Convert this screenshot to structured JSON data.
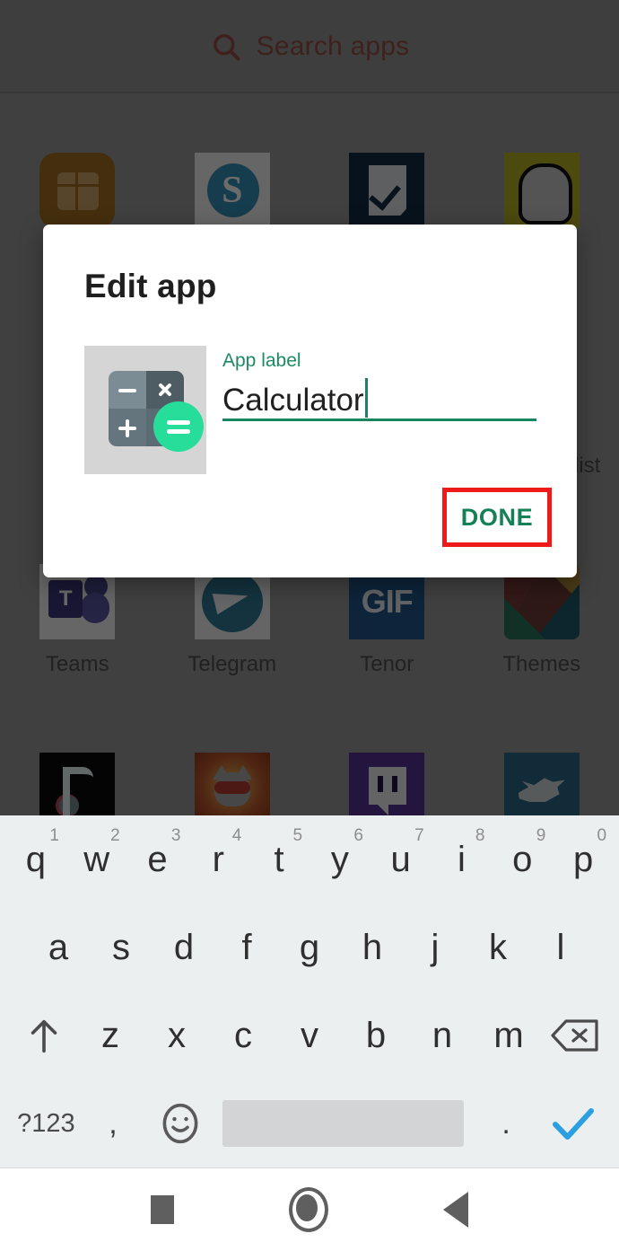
{
  "launcher": {
    "search": {
      "placeholder": "Search apps",
      "icon": "search-icon",
      "text_color": "#6b3a32"
    },
    "partial_label_right": "list",
    "rows": [
      {
        "apps": [
          {
            "name": "",
            "icon": "sim-toolkit-icon"
          },
          {
            "name": "",
            "icon": "skype-icon",
            "glyph": "S"
          },
          {
            "name": "",
            "icon": "todo-checkmark-icon"
          },
          {
            "name": "",
            "icon": "snapchat-icon"
          }
        ]
      },
      {
        "apps": [
          {
            "name": "Teams",
            "icon": "microsoft-teams-icon",
            "glyph": "T"
          },
          {
            "name": "Telegram",
            "icon": "telegram-icon"
          },
          {
            "name": "Tenor",
            "icon": "tenor-icon",
            "glyph": "GIF"
          },
          {
            "name": "Themes",
            "icon": "themes-icon"
          }
        ]
      },
      {
        "apps": [
          {
            "name": "",
            "icon": "tiktok-icon"
          },
          {
            "name": "",
            "icon": "talking-tom-hero-icon"
          },
          {
            "name": "",
            "icon": "twitch-icon"
          },
          {
            "name": "",
            "icon": "twitter-icon"
          }
        ]
      }
    ]
  },
  "dialog": {
    "title": "Edit app",
    "icon_preview": "calculator-icon",
    "field": {
      "label": "App label",
      "value": "Calculator",
      "placeholder": "App label",
      "accent_color": "#18855e"
    },
    "done_label": "DONE",
    "highlight_color": "#ef1b1b"
  },
  "keyboard": {
    "row1": [
      {
        "key": "q",
        "hint": "1"
      },
      {
        "key": "w",
        "hint": "2"
      },
      {
        "key": "e",
        "hint": "3"
      },
      {
        "key": "r",
        "hint": "4"
      },
      {
        "key": "t",
        "hint": "5"
      },
      {
        "key": "y",
        "hint": "6"
      },
      {
        "key": "u",
        "hint": "7"
      },
      {
        "key": "i",
        "hint": "8"
      },
      {
        "key": "o",
        "hint": "9"
      },
      {
        "key": "p",
        "hint": "0"
      }
    ],
    "row2": [
      {
        "key": "a"
      },
      {
        "key": "s"
      },
      {
        "key": "d"
      },
      {
        "key": "f"
      },
      {
        "key": "g"
      },
      {
        "key": "h"
      },
      {
        "key": "j"
      },
      {
        "key": "k"
      },
      {
        "key": "l"
      }
    ],
    "row3_shift": "shift-up-arrow-icon",
    "row3": [
      {
        "key": "z"
      },
      {
        "key": "x"
      },
      {
        "key": "c"
      },
      {
        "key": "v"
      },
      {
        "key": "b"
      },
      {
        "key": "n"
      },
      {
        "key": "m"
      }
    ],
    "row3_delete": "backspace-icon",
    "row4": {
      "symbols_label": "?123",
      "comma": ",",
      "emoji": "emoji-smiley-icon",
      "space": "",
      "period": ".",
      "enter": "enter-checkmark-icon",
      "enter_color": "#2b9fe0"
    }
  },
  "navbar": {
    "recents": "recents-square-icon",
    "home": "home-circle-icon",
    "back": "back-triangle-icon"
  }
}
